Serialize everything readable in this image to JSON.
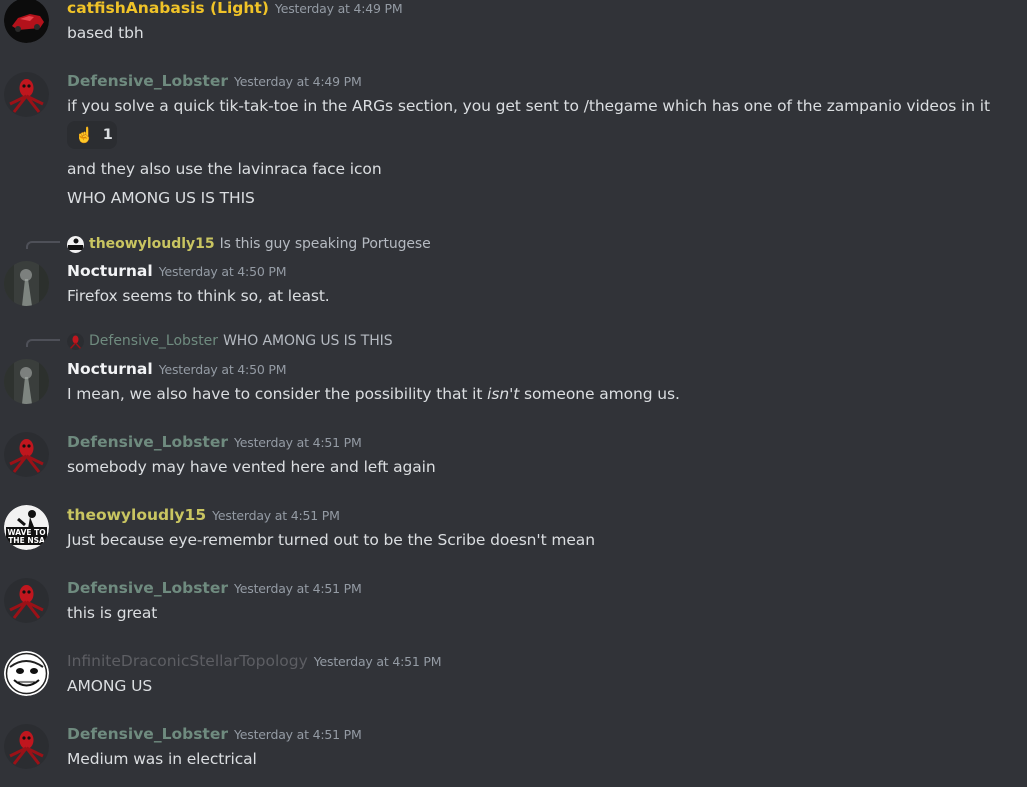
{
  "colors": {
    "background": "#313338",
    "text": "#dbdee1",
    "timestamp": "#949ba4",
    "yellow_user": "#f0c328",
    "green_gray_user": "#6f8b7f",
    "olive_user": "#c9c561",
    "dim_user": "#5d5e63",
    "white_user": "#f2f3f5"
  },
  "messages": [
    {
      "author": "catfishAnabasis (Light)",
      "timestamp": "Yesterday at 4:49 PM",
      "avatar_icon": "red-car-avatar",
      "lines": [
        "based tbh"
      ]
    },
    {
      "author": "Defensive_Lobster",
      "timestamp": "Yesterday at 4:49 PM",
      "avatar_icon": "red-lobster-avatar",
      "lines": [
        "if you solve a quick tik-tak-toe in the ARGs section, you get sent to /thegame which has one of the zampanio videos in it",
        "and they also use the lavinraca face icon",
        "WHO AMONG US IS THIS"
      ],
      "reaction": {
        "emoji": "☝️",
        "emoji_icon": "pointing-up-emoji",
        "count": "1"
      }
    },
    {
      "reply": {
        "author": "theowyloudly15",
        "text": "Is this guy speaking Portugese",
        "avatar_icon": "wave-to-the-nsa-avatar"
      },
      "author": "Nocturnal",
      "timestamp": "Yesterday at 4:50 PM",
      "avatar_icon": "forest-path-avatar",
      "lines": [
        "Firefox seems to think so, at least."
      ]
    },
    {
      "reply": {
        "author": "Defensive_Lobster",
        "text": "WHO AMONG US IS THIS",
        "avatar_icon": "red-lobster-avatar"
      },
      "author": "Nocturnal",
      "timestamp": "Yesterday at 4:50 PM",
      "avatar_icon": "forest-path-avatar",
      "line_before": "I mean, we also have to consider the possibility that it ",
      "line_em": "isn't",
      "line_after": " someone among us."
    },
    {
      "author": "Defensive_Lobster",
      "timestamp": "Yesterday at 4:51 PM",
      "avatar_icon": "red-lobster-avatar",
      "lines": [
        "somebody may have vented here and left again"
      ]
    },
    {
      "author": "theowyloudly15",
      "timestamp": "Yesterday at 4:51 PM",
      "avatar_icon": "wave-to-the-nsa-avatar",
      "avatar_text_1": "WAVE TO",
      "avatar_text_2": "THE NSA",
      "lines": [
        "Just because eye-remembr turned out to be the Scribe doesn't mean"
      ]
    },
    {
      "author": "Defensive_Lobster",
      "timestamp": "Yesterday at 4:51 PM",
      "avatar_icon": "red-lobster-avatar",
      "lines": [
        "this is great"
      ]
    },
    {
      "author": "InfiniteDraconicStellarTopology",
      "timestamp": "Yesterday at 4:51 PM",
      "avatar_icon": "cartoon-face-avatar",
      "lines": [
        "AMONG US"
      ]
    },
    {
      "author": "Defensive_Lobster",
      "timestamp": "Yesterday at 4:51 PM",
      "avatar_icon": "red-lobster-avatar",
      "lines": [
        "Medium was in electrical"
      ]
    }
  ]
}
